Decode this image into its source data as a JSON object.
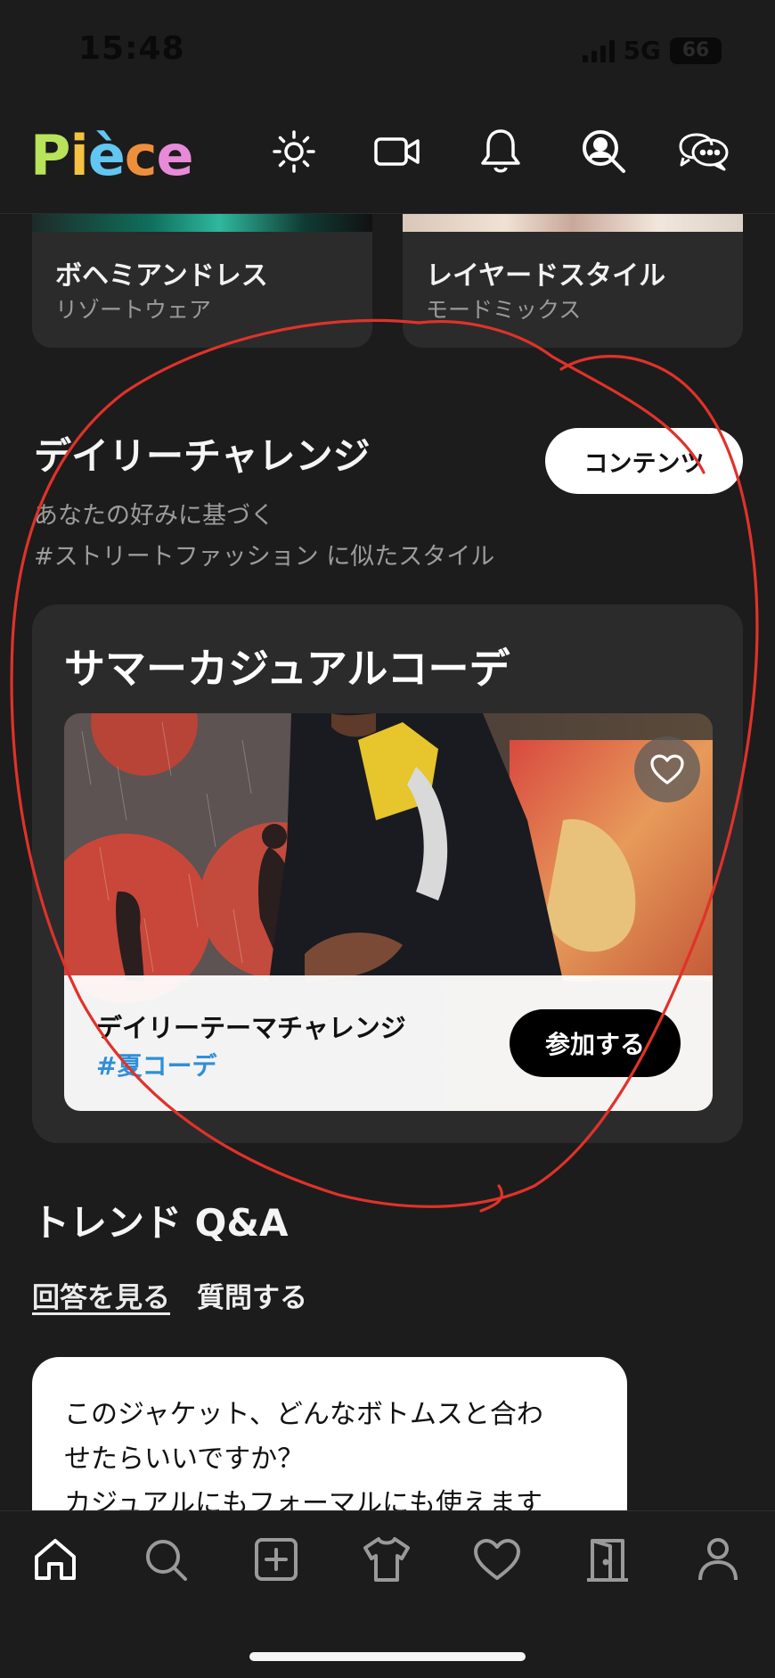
{
  "status": {
    "time": "15:48",
    "network": "5G",
    "battery": "66"
  },
  "header": {
    "logo_letters": [
      "P",
      "i",
      "è",
      "c",
      "e"
    ],
    "logo_colors": [
      "#b8e35a",
      "#f5c242",
      "#62c6f2",
      "#ef8f3c",
      "#e88ad8"
    ],
    "icons": [
      "sun-icon",
      "video-camera-icon",
      "bell-icon",
      "search-user-icon",
      "chat-bubbles-icon"
    ]
  },
  "top_cards": [
    {
      "title": "ボヘミアンドレス",
      "subtitle": "リゾートウェア"
    },
    {
      "title": "レイヤードスタイル",
      "subtitle": "モードミックス"
    }
  ],
  "daily": {
    "title": "デイリーチャレンジ",
    "content_button": "コンテンツ",
    "sub1": "あなたの好みに基づく",
    "sub2": "#ストリートファッション に似たスタイル",
    "card_title": "サマーカジュアルコーデ",
    "challenge_label": "デイリーテーマチャレンジ",
    "hashtag": "#夏コーデ",
    "join_button": "参加する"
  },
  "qa": {
    "title": "トレンド Q&A",
    "tab_answers": "回答を見る",
    "tab_ask": "質問する",
    "question_line1": "このジャケット、どんなボトムスと合わ",
    "question_line2": "せたらいいですか？",
    "question_line3": "カジュアルにもフォーマルにも使えます"
  },
  "tabbar": {
    "icons": [
      "home-icon",
      "search-icon",
      "add-post-icon",
      "shirt-icon",
      "heart-icon",
      "closet-door-icon",
      "profile-icon"
    ]
  },
  "colors": {
    "background": "#1c1c1c",
    "card": "#2b2b2b",
    "hashtag": "#2f8fd8",
    "annotation": "#e0322a"
  }
}
